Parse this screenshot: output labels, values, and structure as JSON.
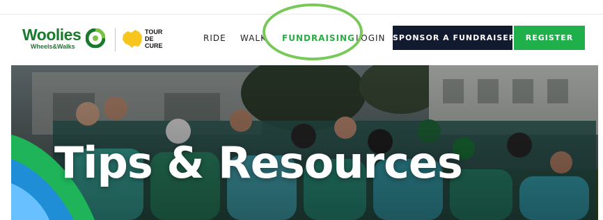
{
  "brand": {
    "woolies_word": "Woolies",
    "woolies_sub": "Wheels&Walks",
    "tour_lines": [
      "TOUR",
      "DE",
      "CURE"
    ]
  },
  "nav": {
    "items": [
      {
        "label": "RIDE"
      },
      {
        "label": "WALK"
      },
      {
        "label": "FUNDRAISING",
        "active": true
      },
      {
        "label": "LOGIN"
      }
    ]
  },
  "buttons": {
    "sponsor": "SPONSOR A FUNDRAISER",
    "register": "REGISTER"
  },
  "hero": {
    "title": "Tips & Resources"
  },
  "colors": {
    "green": "#20b04b",
    "navy": "#111a2e",
    "woolies_green": "#1a7a2c",
    "ring": "#78c95a",
    "tour_yellow": "#f7c51e"
  },
  "icons": [
    "woolies-logo-icon",
    "tour-de-cure-logo-icon"
  ]
}
